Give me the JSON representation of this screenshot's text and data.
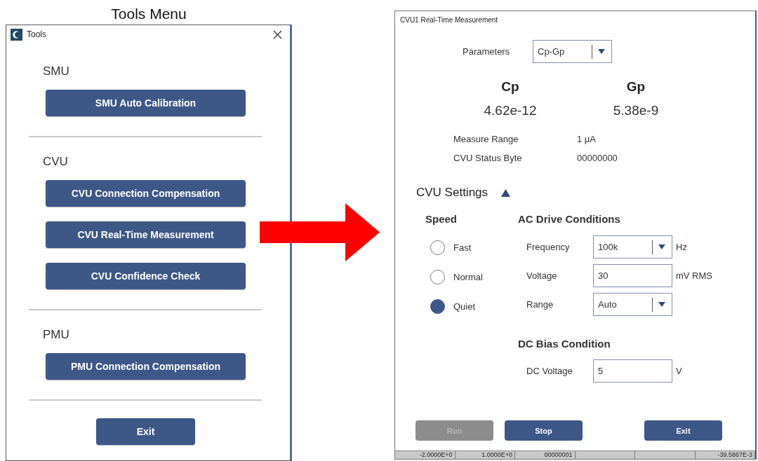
{
  "caption": "Tools Menu",
  "tools_window": {
    "title": "Tools",
    "sections": [
      {
        "heading": "SMU",
        "buttons": [
          "SMU Auto Calibration"
        ]
      },
      {
        "heading": "CVU",
        "buttons": [
          "CVU Connection Compensation",
          "CVU Real-Time Measurement",
          "CVU Confidence Check"
        ]
      },
      {
        "heading": "PMU",
        "buttons": [
          "PMU Connection Compensation"
        ]
      }
    ],
    "exit_button": "Exit"
  },
  "measurement_window": {
    "title": "CVU1 Real-Time Measurement",
    "parameters": {
      "label": "Parameters",
      "value": "Cp-Gp"
    },
    "readings": [
      {
        "name": "Cp",
        "value": "4.62e-12"
      },
      {
        "name": "Gp",
        "value": "5.38e-9"
      }
    ],
    "info": [
      {
        "label": "Measure Range",
        "value": "1 µA"
      },
      {
        "label": "CVU Status Byte",
        "value": "00000000"
      }
    ],
    "settings": {
      "title": "CVU Settings",
      "expanded": true,
      "speed": {
        "heading": "Speed",
        "options": [
          {
            "label": "Fast",
            "selected": false
          },
          {
            "label": "Normal",
            "selected": false
          },
          {
            "label": "Quiet",
            "selected": true
          }
        ]
      },
      "ac_drive": {
        "heading": "AC Drive Conditions",
        "fields": [
          {
            "kind": "dropdown",
            "label": "Frequency",
            "value": "100k",
            "unit": "Hz"
          },
          {
            "kind": "input",
            "label": "Voltage",
            "value": "30",
            "unit": "mV RMS"
          },
          {
            "kind": "dropdown",
            "label": "Range",
            "value": "Auto"
          }
        ]
      },
      "dc_bias": {
        "heading": "DC Bias Condition",
        "fields": [
          {
            "kind": "input",
            "label": "DC Voltage",
            "value": "5",
            "unit": "V"
          }
        ]
      }
    },
    "buttons": [
      {
        "label": "Run",
        "disabled": true
      },
      {
        "label": "Stop",
        "disabled": false
      },
      {
        "label": "Exit",
        "disabled": false
      }
    ]
  },
  "background_table_row": [
    {
      "kind": "value",
      "text": "-2.0000E+0"
    },
    {
      "kind": "value",
      "text": "1.0000E+0"
    },
    {
      "kind": "value",
      "text": "00000001"
    },
    {
      "kind": "blank"
    },
    {
      "kind": "blank"
    },
    {
      "kind": "value",
      "text": "-39.5867E-3"
    }
  ]
}
